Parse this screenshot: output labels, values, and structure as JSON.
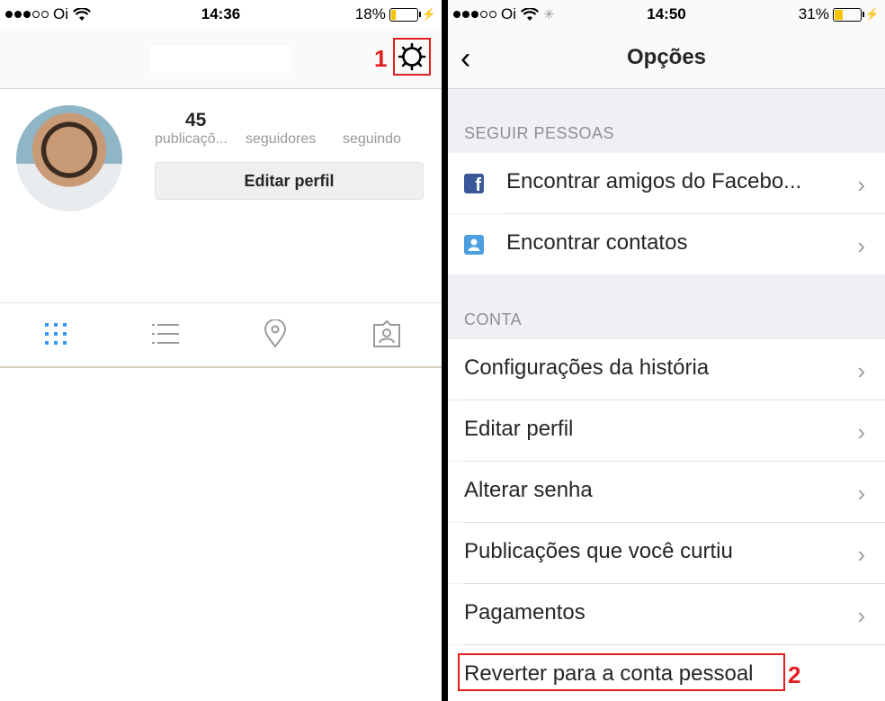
{
  "left": {
    "status": {
      "carrier": "Oi",
      "time": "14:36",
      "battery": "18%",
      "battery_level": 0.18
    },
    "annotation": "1",
    "stats": {
      "posts_count": "45",
      "posts_label": "publicaçõ...",
      "followers_label": "seguidores",
      "following_label": "seguindo"
    },
    "edit_profile": "Editar perfil",
    "tabs": [
      "grid-icon",
      "list-icon",
      "location-pin-icon",
      "tagged-photos-icon"
    ]
  },
  "right": {
    "status": {
      "carrier": "Oi",
      "time": "14:50",
      "battery": "31%",
      "battery_level": 0.31
    },
    "title": "Opções",
    "sections": [
      {
        "header": "SEGUIR PESSOAS",
        "items": [
          "Encontrar amigos do Facebo...",
          "Encontrar contatos"
        ]
      },
      {
        "header": "CONTA",
        "items": [
          "Configurações da história",
          "Editar perfil",
          "Alterar senha",
          "Publicações que você curtiu",
          "Pagamentos",
          "Reverter para a conta pessoal"
        ]
      }
    ],
    "annotation": "2"
  },
  "colors": {
    "annotation_red": "#e01f1f",
    "accent_blue": "#3897f0",
    "facebook": "#3b5998"
  }
}
